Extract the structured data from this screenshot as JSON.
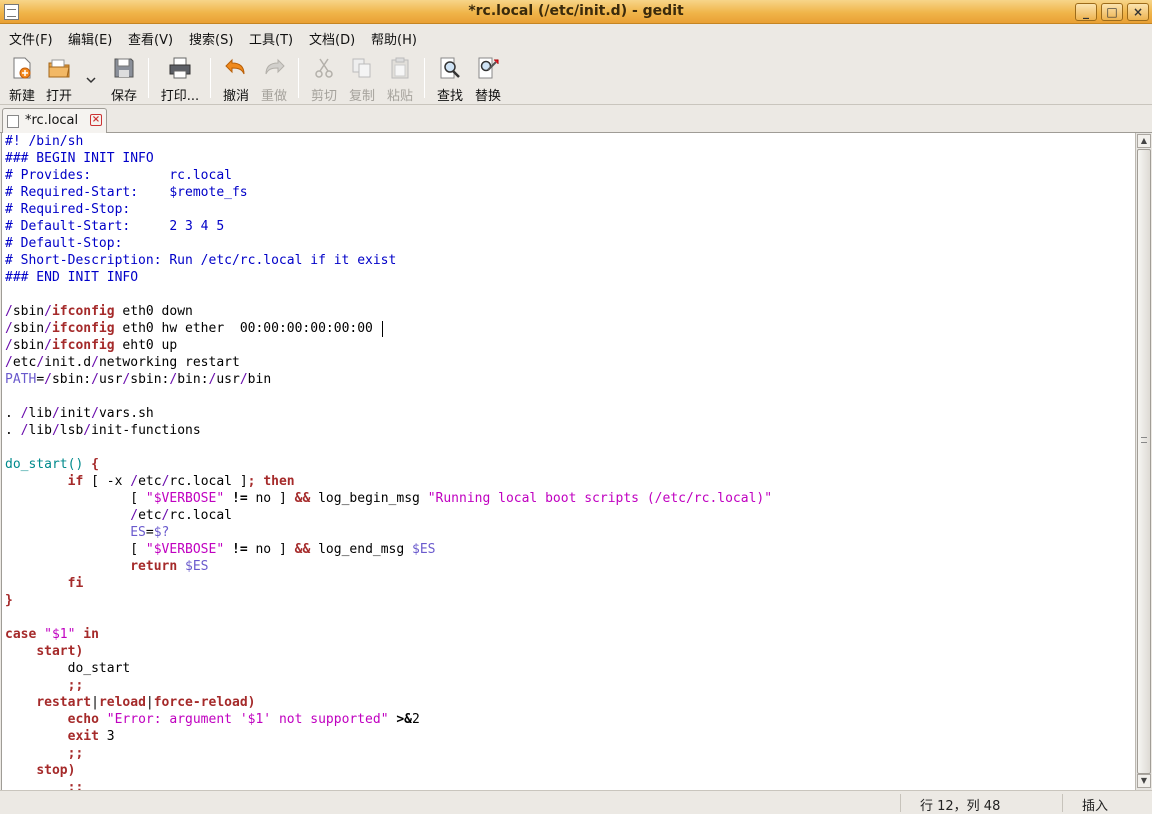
{
  "window": {
    "title": "*rc.local (/etc/init.d) - gedit"
  },
  "menu": [
    "文件(F)",
    "编辑(E)",
    "查看(V)",
    "搜索(S)",
    "工具(T)",
    "文档(D)",
    "帮助(H)"
  ],
  "toolbar": {
    "new": "新建",
    "open": "打开",
    "save": "保存",
    "print": "打印...",
    "undo": "撤消",
    "redo": "重做",
    "cut": "剪切",
    "copy": "复制",
    "paste": "粘贴",
    "find": "查找",
    "replace": "替换"
  },
  "tab": {
    "name": "*rc.local"
  },
  "colors": {
    "comment": "#0000c8",
    "keyword": "#a52a2a",
    "string": "#c000c0",
    "variable": "#6a5acd",
    "function": "#008a8c",
    "path": "#6a0dad"
  },
  "code_lines": [
    [
      [
        "c",
        "#! /bin/sh"
      ]
    ],
    [
      [
        "c",
        "### BEGIN INIT INFO"
      ]
    ],
    [
      [
        "c",
        "# Provides:          rc.local"
      ]
    ],
    [
      [
        "c",
        "# Required-Start:    $remote_fs"
      ]
    ],
    [
      [
        "c",
        "# Required-Stop:"
      ]
    ],
    [
      [
        "c",
        "# Default-Start:     2 3 4 5"
      ]
    ],
    [
      [
        "c",
        "# Default-Stop:"
      ]
    ],
    [
      [
        "c",
        "# Short-Description: Run /etc/rc.local if it exist"
      ]
    ],
    [
      [
        "c",
        "### END INIT INFO"
      ]
    ],
    [],
    [
      [
        "p",
        "/"
      ],
      [
        "t",
        "sbin"
      ],
      [
        "p",
        "/"
      ],
      [
        "k",
        "ifconfig"
      ],
      [
        "t",
        " eth0 down"
      ]
    ],
    [
      [
        "p",
        "/"
      ],
      [
        "t",
        "sbin"
      ],
      [
        "p",
        "/"
      ],
      [
        "k",
        "ifconfig"
      ],
      [
        "t",
        " eth0 hw ether  00:00:00:00:00:00"
      ]
    ],
    [
      [
        "p",
        "/"
      ],
      [
        "t",
        "sbin"
      ],
      [
        "p",
        "/"
      ],
      [
        "k",
        "ifconfig"
      ],
      [
        "t",
        " eht0 up"
      ]
    ],
    [
      [
        "p",
        "/"
      ],
      [
        "t",
        "etc"
      ],
      [
        "p",
        "/"
      ],
      [
        "t",
        "init.d"
      ],
      [
        "p",
        "/"
      ],
      [
        "t",
        "networking restart"
      ]
    ],
    [
      [
        "v",
        "PATH"
      ],
      [
        "t",
        "="
      ],
      [
        "p",
        "/"
      ],
      [
        "t",
        "sbin:"
      ],
      [
        "p",
        "/"
      ],
      [
        "t",
        "usr"
      ],
      [
        "p",
        "/"
      ],
      [
        "t",
        "sbin:"
      ],
      [
        "p",
        "/"
      ],
      [
        "t",
        "bin:"
      ],
      [
        "p",
        "/"
      ],
      [
        "t",
        "usr"
      ],
      [
        "p",
        "/"
      ],
      [
        "t",
        "bin"
      ]
    ],
    [],
    [
      [
        "t",
        ". "
      ],
      [
        "p",
        "/"
      ],
      [
        "t",
        "lib"
      ],
      [
        "p",
        "/"
      ],
      [
        "t",
        "init"
      ],
      [
        "p",
        "/"
      ],
      [
        "t",
        "vars.sh"
      ]
    ],
    [
      [
        "t",
        ". "
      ],
      [
        "p",
        "/"
      ],
      [
        "t",
        "lib"
      ],
      [
        "p",
        "/"
      ],
      [
        "t",
        "lsb"
      ],
      [
        "p",
        "/"
      ],
      [
        "t",
        "init-functions"
      ]
    ],
    [],
    [
      [
        "f",
        "do_start()"
      ],
      [
        "t",
        " "
      ],
      [
        "k",
        "{"
      ]
    ],
    [
      [
        "t",
        "        "
      ],
      [
        "k",
        "if"
      ],
      [
        "t",
        " [ -x "
      ],
      [
        "p",
        "/"
      ],
      [
        "t",
        "etc"
      ],
      [
        "p",
        "/"
      ],
      [
        "t",
        "rc.local ]"
      ],
      [
        "k",
        "; then"
      ]
    ],
    [
      [
        "t",
        "                [ "
      ],
      [
        "s",
        "\"$VERBOSE\""
      ],
      [
        "t",
        " "
      ],
      [
        "b",
        "!="
      ],
      [
        "t",
        " no ] "
      ],
      [
        "k",
        "&&"
      ],
      [
        "t",
        " log_begin_msg "
      ],
      [
        "s",
        "\"Running local boot scripts (/etc/rc.local)\""
      ]
    ],
    [
      [
        "t",
        "                "
      ],
      [
        "p",
        "/"
      ],
      [
        "t",
        "etc"
      ],
      [
        "p",
        "/"
      ],
      [
        "t",
        "rc.local"
      ]
    ],
    [
      [
        "t",
        "                "
      ],
      [
        "v",
        "ES"
      ],
      [
        "t",
        "="
      ],
      [
        "v",
        "$?"
      ]
    ],
    [
      [
        "t",
        "                [ "
      ],
      [
        "s",
        "\"$VERBOSE\""
      ],
      [
        "t",
        " "
      ],
      [
        "b",
        "!="
      ],
      [
        "t",
        " no ] "
      ],
      [
        "k",
        "&&"
      ],
      [
        "t",
        " log_end_msg "
      ],
      [
        "v",
        "$ES"
      ]
    ],
    [
      [
        "t",
        "                "
      ],
      [
        "k",
        "return"
      ],
      [
        "t",
        " "
      ],
      [
        "v",
        "$ES"
      ]
    ],
    [
      [
        "t",
        "        "
      ],
      [
        "k",
        "fi"
      ]
    ],
    [
      [
        "k",
        "}"
      ]
    ],
    [],
    [
      [
        "k",
        "case"
      ],
      [
        "t",
        " "
      ],
      [
        "s",
        "\"$1\""
      ],
      [
        "t",
        " "
      ],
      [
        "k",
        "in"
      ]
    ],
    [
      [
        "t",
        "    "
      ],
      [
        "k",
        "start)"
      ]
    ],
    [
      [
        "t",
        "        do_start"
      ]
    ],
    [
      [
        "t",
        "        "
      ],
      [
        "k",
        ";;"
      ]
    ],
    [
      [
        "t",
        "    "
      ],
      [
        "k",
        "restart"
      ],
      [
        "t",
        "|"
      ],
      [
        "k",
        "reload"
      ],
      [
        "t",
        "|"
      ],
      [
        "k",
        "force-reload)"
      ]
    ],
    [
      [
        "t",
        "        "
      ],
      [
        "k",
        "echo"
      ],
      [
        "t",
        " "
      ],
      [
        "s",
        "\"Error: argument '$1' not supported\""
      ],
      [
        "t",
        " "
      ],
      [
        "b",
        ">&"
      ],
      [
        "t",
        "2"
      ]
    ],
    [
      [
        "t",
        "        "
      ],
      [
        "k",
        "exit"
      ],
      [
        "t",
        " 3"
      ]
    ],
    [
      [
        "t",
        "        "
      ],
      [
        "k",
        ";;"
      ]
    ],
    [
      [
        "t",
        "    "
      ],
      [
        "k",
        "stop)"
      ]
    ],
    [
      [
        "t",
        "        "
      ],
      [
        "k",
        ";;"
      ]
    ]
  ],
  "status": {
    "position": "行 12，列 48",
    "mode": "插入"
  }
}
